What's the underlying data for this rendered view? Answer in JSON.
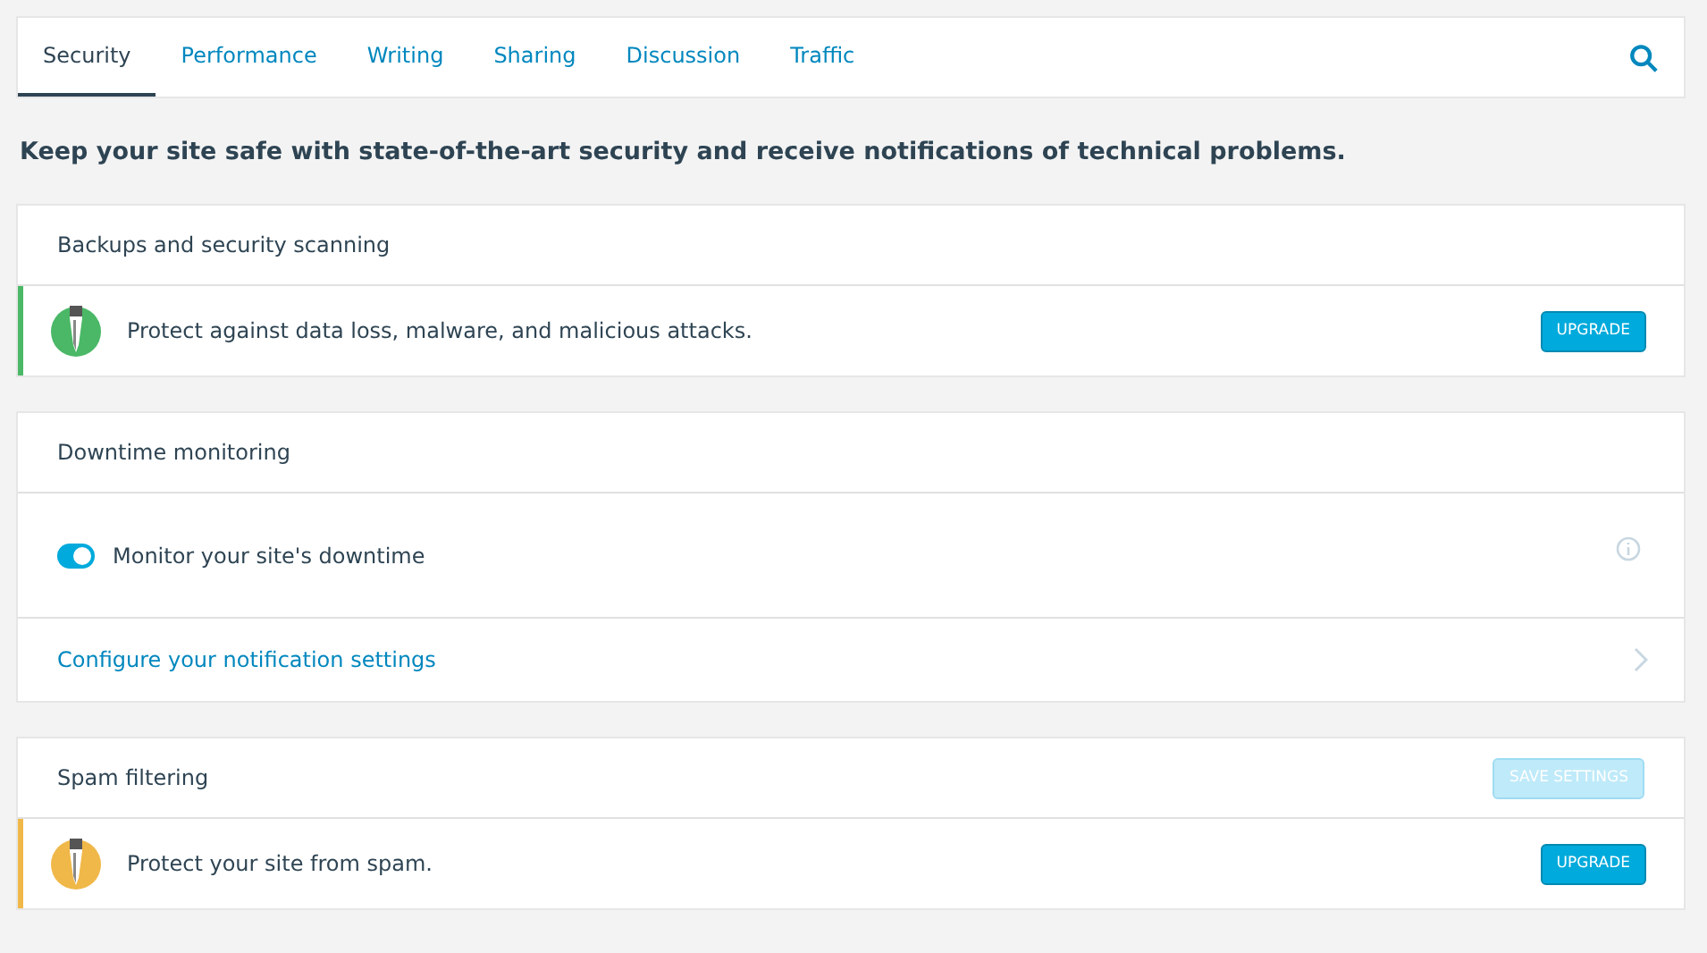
{
  "tabs": [
    {
      "label": "Security",
      "selected": true
    },
    {
      "label": "Performance",
      "selected": false
    },
    {
      "label": "Writing",
      "selected": false
    },
    {
      "label": "Sharing",
      "selected": false
    },
    {
      "label": "Discussion",
      "selected": false
    },
    {
      "label": "Traffic",
      "selected": false
    }
  ],
  "intro": "Keep your site safe with state-of-the-art security and receive notifications of technical problems.",
  "sections": [
    {
      "title": "Backups and security scanning",
      "rows": [
        {
          "kind": "nudge",
          "color": "#4ab866",
          "text": "Protect against data loss, malware, and malicious attacks.",
          "button": "UPGRADE"
        }
      ]
    },
    {
      "title": "Downtime monitoring",
      "rows": [
        {
          "kind": "toggle",
          "on": true,
          "text": "Monitor your site's downtime"
        },
        {
          "kind": "link",
          "text": "Configure your notification settings"
        }
      ]
    },
    {
      "title": "Spam filtering",
      "header_button": {
        "label": "SAVE SETTINGS",
        "disabled": true
      },
      "rows": [
        {
          "kind": "nudge",
          "color": "#f0b849",
          "text": "Protect your site from spam.",
          "button": "UPGRADE"
        }
      ]
    }
  ]
}
